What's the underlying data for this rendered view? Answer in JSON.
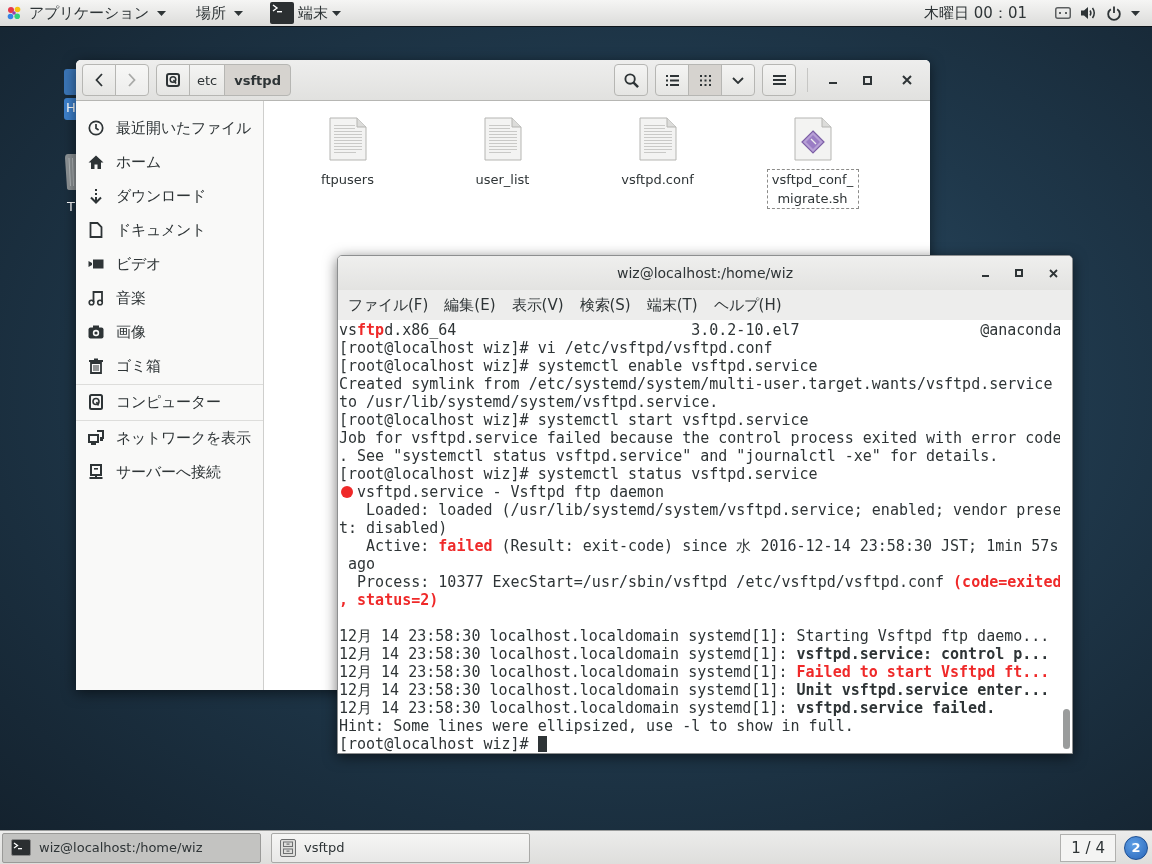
{
  "top_bar": {
    "menus": [
      {
        "kind": "apps",
        "label": "アプリケーション"
      },
      {
        "kind": "places",
        "label": "場所"
      },
      {
        "kind": "app",
        "label": "端末"
      }
    ],
    "clock": "木曜日 00：01"
  },
  "desktop_icons": [
    {
      "kind": "folder",
      "label": "H"
    },
    {
      "kind": "trash",
      "label": "T"
    }
  ],
  "file_manager": {
    "nav": [
      {
        "kind": "back",
        "disabled": false
      },
      {
        "kind": "forward",
        "disabled": true
      }
    ],
    "path": [
      {
        "kind": "computer",
        "selected": false
      },
      {
        "kind": "folder",
        "label": "etc",
        "selected": false
      },
      {
        "kind": "folder",
        "label": "vsftpd",
        "selected": true
      }
    ],
    "view_buttons": [
      {
        "kind": "list",
        "selected": false
      },
      {
        "kind": "grid",
        "selected": true
      },
      {
        "kind": "options",
        "selected": false
      }
    ],
    "sidebar": [
      {
        "items": [
          {
            "kind": "recent",
            "label": "最近開いたファイル",
            "selected": false
          },
          {
            "kind": "home",
            "label": "ホーム",
            "selected": false
          },
          {
            "kind": "download",
            "label": "ダウンロード",
            "selected": false
          },
          {
            "kind": "document",
            "label": "ドキュメント",
            "selected": false
          },
          {
            "kind": "video",
            "label": "ビデオ",
            "selected": false
          },
          {
            "kind": "music",
            "label": "音楽",
            "selected": false
          },
          {
            "kind": "picture",
            "label": "画像",
            "selected": false
          },
          {
            "kind": "trash",
            "label": "ゴミ箱",
            "selected": false
          }
        ]
      },
      {
        "items": [
          {
            "kind": "computer",
            "label": "コンピューター",
            "selected": false
          }
        ]
      },
      {
        "items": [
          {
            "kind": "network",
            "label": "ネットワークを表示",
            "selected": false
          },
          {
            "kind": "server",
            "label": "サーバーへ接続",
            "selected": false
          }
        ]
      }
    ],
    "files": [
      {
        "kind": "text",
        "name": "ftpusers",
        "focused": false
      },
      {
        "kind": "text",
        "name": "user_list",
        "focused": false
      },
      {
        "kind": "text",
        "name": "vsftpd.conf",
        "focused": false
      },
      {
        "kind": "script",
        "name": "vsftpd_conf_migrate.sh",
        "focused": true
      }
    ]
  },
  "terminal": {
    "title": "wiz@localhost:/home/wiz",
    "menu": [
      "ファイル(F)",
      "編集(E)",
      "表示(V)",
      "検索(S)",
      "端末(T)",
      "ヘルプ(H)"
    ],
    "lines": [
      {
        "kind": "text",
        "segments": [
          {
            "kind": "plain",
            "text": "vs"
          },
          {
            "kind": "red",
            "text": "ftp"
          },
          {
            "kind": "plain",
            "text": "d.x86_64                          3.0.2-10.el7                    @anaconda"
          }
        ]
      },
      {
        "kind": "text",
        "segments": [
          {
            "kind": "plain",
            "text": "[root@localhost wiz]# vi /etc/vsftpd/vsftpd.conf"
          }
        ]
      },
      {
        "kind": "text",
        "segments": [
          {
            "kind": "plain",
            "text": "[root@localhost wiz]# systemctl enable vsftpd.service"
          }
        ]
      },
      {
        "kind": "text",
        "segments": [
          {
            "kind": "plain",
            "text": "Created symlink from /etc/systemd/system/multi-user.target.wants/vsftpd.service"
          }
        ]
      },
      {
        "kind": "text",
        "segments": [
          {
            "kind": "plain",
            "text": "to /usr/lib/systemd/system/vsftpd.service."
          }
        ]
      },
      {
        "kind": "text",
        "segments": [
          {
            "kind": "plain",
            "text": "[root@localhost wiz]# systemctl start vsftpd.service"
          }
        ]
      },
      {
        "kind": "text",
        "segments": [
          {
            "kind": "plain",
            "text": "Job for vsftpd.service failed because the control process exited with error code"
          }
        ]
      },
      {
        "kind": "text",
        "segments": [
          {
            "kind": "plain",
            "text": ". See \"systemctl status vsftpd.service\" and \"journalctl -xe\" for details."
          }
        ]
      },
      {
        "kind": "text",
        "segments": [
          {
            "kind": "plain",
            "text": "[root@localhost wiz]# systemctl status vsftpd.service"
          }
        ]
      },
      {
        "kind": "text",
        "segments": [
          {
            "kind": "dot"
          },
          {
            "kind": "plain",
            "text": "vsftpd.service - Vsftpd ftp daemon"
          }
        ]
      },
      {
        "kind": "text",
        "segments": [
          {
            "kind": "plain",
            "text": "   Loaded: loaded (/usr/lib/systemd/system/vsftpd.service; enabled; vendor prese"
          }
        ]
      },
      {
        "kind": "text",
        "segments": [
          {
            "kind": "plain",
            "text": "t: disabled)"
          }
        ]
      },
      {
        "kind": "text",
        "segments": [
          {
            "kind": "plain",
            "text": "   Active: "
          },
          {
            "kind": "red",
            "text": "failed"
          },
          {
            "kind": "plain",
            "text": " (Result: exit-code) since 水 2016-12-14 23:58:30 JST; 1min 57s"
          }
        ]
      },
      {
        "kind": "text",
        "segments": [
          {
            "kind": "plain",
            "text": " ago"
          }
        ]
      },
      {
        "kind": "text",
        "segments": [
          {
            "kind": "plain",
            "text": "  Process: 10377 ExecStart=/usr/sbin/vsftpd /etc/vsftpd/vsftpd.conf "
          },
          {
            "kind": "red",
            "text": "(code=exited"
          }
        ]
      },
      {
        "kind": "text",
        "segments": [
          {
            "kind": "red",
            "text": ", status=2)"
          }
        ]
      },
      {
        "kind": "blank"
      },
      {
        "kind": "text",
        "segments": [
          {
            "kind": "plain",
            "text": "12月 14 23:58:30 localhost.localdomain systemd[1]: Starting Vsftpd ftp daemo..."
          }
        ]
      },
      {
        "kind": "text",
        "segments": [
          {
            "kind": "plain",
            "text": "12月 14 23:58:30 localhost.localdomain systemd[1]: "
          },
          {
            "kind": "bold",
            "text": "vsftpd.service: control p..."
          }
        ]
      },
      {
        "kind": "text",
        "segments": [
          {
            "kind": "plain",
            "text": "12月 14 23:58:30 localhost.localdomain systemd[1]: "
          },
          {
            "kind": "red",
            "text": "Failed to start Vsftpd ft..."
          }
        ]
      },
      {
        "kind": "text",
        "segments": [
          {
            "kind": "plain",
            "text": "12月 14 23:58:30 localhost.localdomain systemd[1]: "
          },
          {
            "kind": "bold",
            "text": "Unit vsftpd.service enter..."
          }
        ]
      },
      {
        "kind": "text",
        "segments": [
          {
            "kind": "plain",
            "text": "12月 14 23:58:30 localhost.localdomain systemd[1]: "
          },
          {
            "kind": "bold",
            "text": "vsftpd.service failed."
          }
        ]
      },
      {
        "kind": "text",
        "segments": [
          {
            "kind": "plain",
            "text": "Hint: Some lines were ellipsized, use -l to show in full."
          }
        ]
      },
      {
        "kind": "text",
        "segments": [
          {
            "kind": "plain",
            "text": "[root@localhost wiz]# "
          },
          {
            "kind": "cursor"
          }
        ]
      }
    ]
  },
  "taskbar": {
    "tasks": [
      {
        "kind": "terminal",
        "label": "wiz@localhost:/home/wiz",
        "selected": true
      },
      {
        "kind": "files",
        "label": "vsftpd",
        "selected": false
      }
    ],
    "workspace": "1 / 4",
    "notifications": "2"
  }
}
